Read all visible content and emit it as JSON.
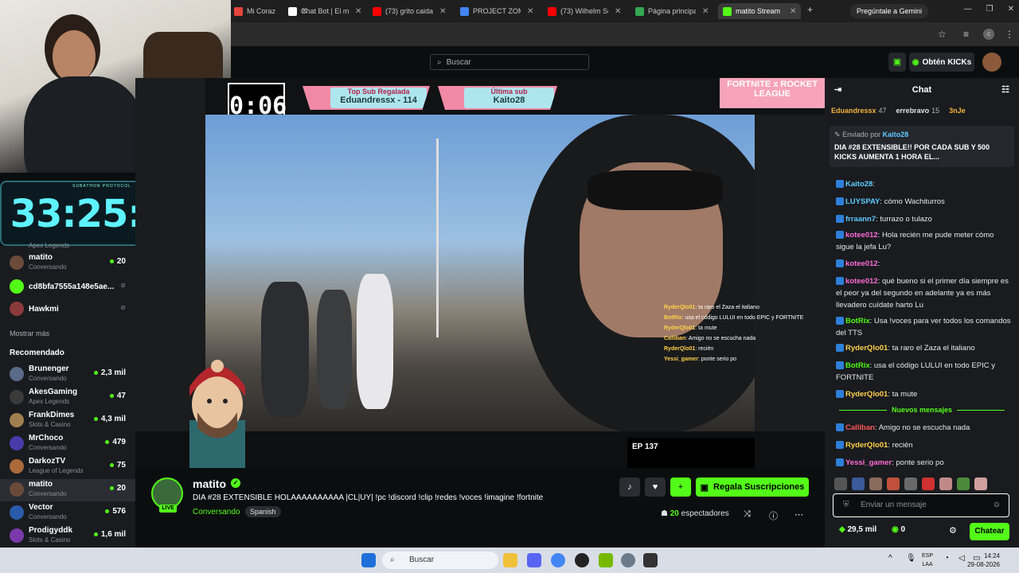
{
  "browser": {
    "tabs": [
      {
        "title": "Mi Coraz",
        "fav": "#e5443d"
      },
      {
        "title": "Chat Bot | El mej",
        "fav": "#ffffff"
      },
      {
        "title": "(73) grito caida n",
        "fav": "#ff0000"
      },
      {
        "title": "PROJECT ZOMBO",
        "fav": "#4285f4"
      },
      {
        "title": "(73) Wilhelm Scre",
        "fav": "#ff0000"
      },
      {
        "title": "Página principal",
        "fav": "#34a853"
      },
      {
        "title": "matito Stream",
        "fav": "#53fc18"
      }
    ],
    "gemini_label": "Pregúntale a Gemini"
  },
  "header": {
    "search_placeholder": "Buscar",
    "kicks_label": "Obtén KICKs"
  },
  "timer": {
    "label": "SUBATHON PROTOCOL",
    "value": "33:25:38"
  },
  "overlay": {
    "top_sub_label": "Top Sub Regalada",
    "top_sub_value": "Eduandressx - 114",
    "last_sub_label": "Última sub",
    "last_sub_value": "Kaito28",
    "countdown": "0:06",
    "fortnite": "FORTNITE x ROCKET LEAGUE",
    "ep_label": "EP 137",
    "video_chat": [
      {
        "user": "RyderQlo01",
        "text": ": ta raro el Zaza el italiano"
      },
      {
        "user": "BotRix",
        "text": ": usa el código LULUI en todo EPIC y FORTNITE"
      },
      {
        "user": "RyderQlo01",
        "text": ": ta mute"
      },
      {
        "user": "Calliban",
        "text": ": Amigo no se escucha nada"
      },
      {
        "user": "RyderQlo01",
        "text": ": recién"
      },
      {
        "user": "Yessi_gamer",
        "text": ": ponte serio po"
      }
    ]
  },
  "sidebar": {
    "following_partial": "Apex Legends",
    "following": [
      {
        "name": "matito",
        "cat": "Conversando",
        "count": "20",
        "color": "#6b4a3a",
        "active": false
      },
      {
        "name": "cd8bfa7555a148e5ae...",
        "cat": "",
        "count": "",
        "color": "#53fc18",
        "active": false
      },
      {
        "name": "Hawkmi",
        "cat": "",
        "count": "",
        "color": "#8a3a3a",
        "active": false
      }
    ],
    "show_more": "Mostrar más",
    "recommended_title": "Recomendado",
    "recommended": [
      {
        "name": "Brunenger",
        "cat": "Conversando",
        "count": "2,3 mil",
        "color": "#5a6a8a"
      },
      {
        "name": "AkesGaming",
        "cat": "Apex Legends",
        "count": "47",
        "color": "#3a3a3a"
      },
      {
        "name": "FrankDimes",
        "cat": "Slots & Casino",
        "count": "4,3 mil",
        "color": "#a08050"
      },
      {
        "name": "MrChoco",
        "cat": "Conversando",
        "count": "479",
        "color": "#4a3aaa"
      },
      {
        "name": "DarkozTV",
        "cat": "League of Legends",
        "count": "75",
        "color": "#aa6a3a"
      },
      {
        "name": "matito",
        "cat": "Conversando",
        "count": "20",
        "color": "#6b4a3a"
      },
      {
        "name": "Vector",
        "cat": "Conversando",
        "count": "576",
        "color": "#2a5aaa"
      },
      {
        "name": "Prodigyddk",
        "cat": "Slots & Casino",
        "count": "1,6 mil",
        "color": "#7a3aaa"
      }
    ]
  },
  "stream": {
    "channel": "matito",
    "live": "LIVE",
    "title": "DIA #28 EXTENSIBLE HOLAAAAAAAAAA |CL|UY|  !pc !discord !clip !redes !voces !imagine !fortnite",
    "category": "Conversando",
    "language": "Spanish",
    "sub_button": "Regala Suscripciones",
    "viewers_count": "20",
    "viewers_label": "espectadores"
  },
  "chat": {
    "title": "Chat",
    "gifters": [
      {
        "name": "Eduandressx",
        "count": "47",
        "color": "#f2b43a"
      },
      {
        "name": "errebravo",
        "count": "15",
        "color": "#dfe2e4"
      },
      {
        "name": "3nJe",
        "count": "",
        "color": "#f2b43a"
      }
    ],
    "pinned_by_label": "Enviado por",
    "pinned_by_user": "Kaito28",
    "pinned_msg": "DIA #28 EXTENSIBLE!! POR CADA SUB Y 500 KICKS AUMENTA 1 HORA EL...",
    "messages": [
      {
        "user": "Kaito28",
        "text": ":",
        "color": "#5ecbff"
      },
      {
        "user": "LUYSPAY",
        "text": ": cómo Wachiturros",
        "color": "#5ecbff"
      },
      {
        "user": "frraann7",
        "text": ": turrazo o tulazo",
        "color": "#5ecbff"
      },
      {
        "user": "kotee012",
        "text": ": Hola recién me pude meter cómo sigue la jefa Lu?",
        "color": "#ff6bd5"
      },
      {
        "user": "kotee012",
        "text": ":",
        "color": "#ff6bd5"
      },
      {
        "user": "kotee012",
        "text": ": qué bueno si el primer día siempre es el peor ya del segundo en adelante ya es más llevadero cuídate harto Lu",
        "color": "#ff6bd5"
      },
      {
        "user": "BotRix",
        "text": ": Usa !voces para ver todos los comandos del TTS",
        "color": "#53fc18"
      },
      {
        "user": "RyderQlo01",
        "text": ": ta raro el Zaza el italiano",
        "color": "#ffd24a"
      },
      {
        "user": "BotRix",
        "text": ": usa el código LULUI en todo EPIC y FORTNITE",
        "color": "#53fc18"
      },
      {
        "user": "RyderQlo01",
        "text": ": ta mute",
        "color": "#ffd24a"
      }
    ],
    "new_messages_label": "Nuevos mensajes",
    "new_messages": [
      {
        "user": "Calliban",
        "text": ": Amigo no se escucha nada",
        "color": "#ff5a5a"
      },
      {
        "user": "RyderQlo01",
        "text": ": recién",
        "color": "#ffd24a"
      },
      {
        "user": "Yessi_gamer",
        "text": ": ponte serio po",
        "color": "#ff6bd5"
      }
    ],
    "input_placeholder": "Enviar un mensaje",
    "balance_kicks": "29,5 mil",
    "balance_points": "0",
    "send_label": "Chatear"
  },
  "taskbar": {
    "search": "Buscar",
    "lang1": "ESP",
    "lang2": "LAA",
    "time": "14:24",
    "date": "29-08-2026"
  }
}
